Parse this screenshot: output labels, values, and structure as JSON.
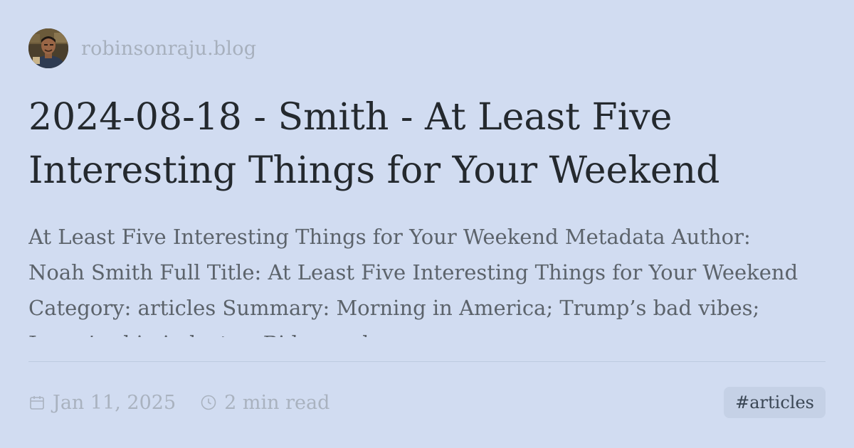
{
  "site": {
    "name": "robinsonraju.blog",
    "avatar": "author-avatar-photo"
  },
  "post": {
    "title": "2024-08-18 - Smith - At Least Five Interesting Things for Your Weekend",
    "summary": "At Least Five Interesting Things for Your Weekend Metadata Author: Noah Smith Full Title: At Least Five Interesting Things for Your Weekend Category: articles Summary: Morning in America; Trump’s bad vibes; Japan’s chip industry; Biden and"
  },
  "meta": {
    "date": "Jan 11, 2025",
    "date_icon": "calendar-icon",
    "read_time": "2 min read",
    "read_time_icon": "clock-icon",
    "tag": "#articles"
  },
  "colors": {
    "background": "#d1dcf1",
    "title": "#24292e",
    "muted": "#a9b2bf",
    "tag_bg": "#c5d1e6"
  }
}
